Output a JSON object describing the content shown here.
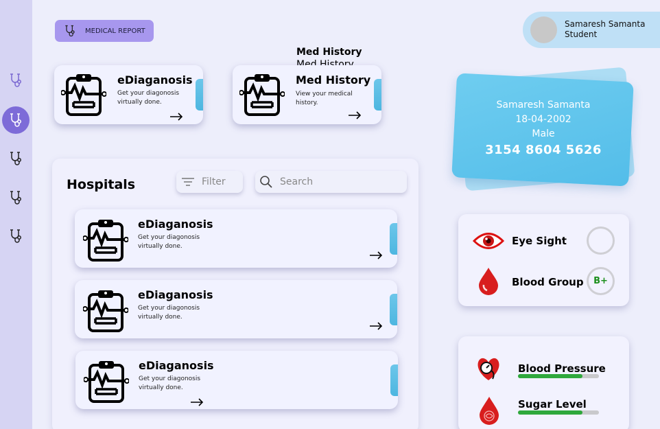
{
  "header": {
    "report_button": "MEDICAL REPORT"
  },
  "profile": {
    "name": "Samaresh Samanta",
    "role": "Student"
  },
  "sidebar": {
    "items": [
      {
        "icon": "stethoscope-icon",
        "active": false
      },
      {
        "icon": "stethoscope-icon",
        "active": true
      },
      {
        "icon": "stethoscope-icon",
        "active": false
      },
      {
        "icon": "stethoscope-icon",
        "active": false
      },
      {
        "icon": "stethoscope-icon",
        "active": false
      }
    ]
  },
  "top_cards": [
    {
      "title": "eDiaganosis",
      "desc_line1": "Get your diagonosis",
      "desc_line2": "virtually done."
    },
    {
      "title": "Med History",
      "desc_line1": "View your medical",
      "desc_line2": "history."
    }
  ],
  "med_history_overlay": [
    "Med History",
    "Med History"
  ],
  "id_card": {
    "name": "Samaresh Samanta",
    "dob": "18-04-2002",
    "gender": "Male",
    "number": "3154 8604 5626"
  },
  "hospitals": {
    "title": "Hospitals",
    "filter_placeholder": "Filter",
    "search_placeholder": "Search",
    "items": [
      {
        "title": "eDiaganosis",
        "desc_line1": "Get your diagonosis",
        "desc_line2": "virtually done."
      },
      {
        "title": "eDiaganosis",
        "desc_line1": "Get your diagonosis",
        "desc_line2": "virtually done."
      },
      {
        "title": "eDiaganosis",
        "desc_line1": "Get your diagonosis",
        "desc_line2": "virtually done."
      }
    ]
  },
  "vitals": {
    "eye_sight_label": "Eye Sight",
    "eye_sight_value": "",
    "blood_group_label": "Blood Group",
    "blood_group_value": "B+"
  },
  "health": {
    "blood_pressure_label": "Blood Pressure",
    "blood_pressure_level": 0.8,
    "sugar_level_label": "Sugar Level",
    "sugar_level_level": 0.8
  },
  "colors": {
    "accent": "#7d6bd8",
    "card_tab": "#4db6e0",
    "id_card": "#5fc4ec",
    "progress": "#2fa83c",
    "blood": "#d81e1e"
  }
}
